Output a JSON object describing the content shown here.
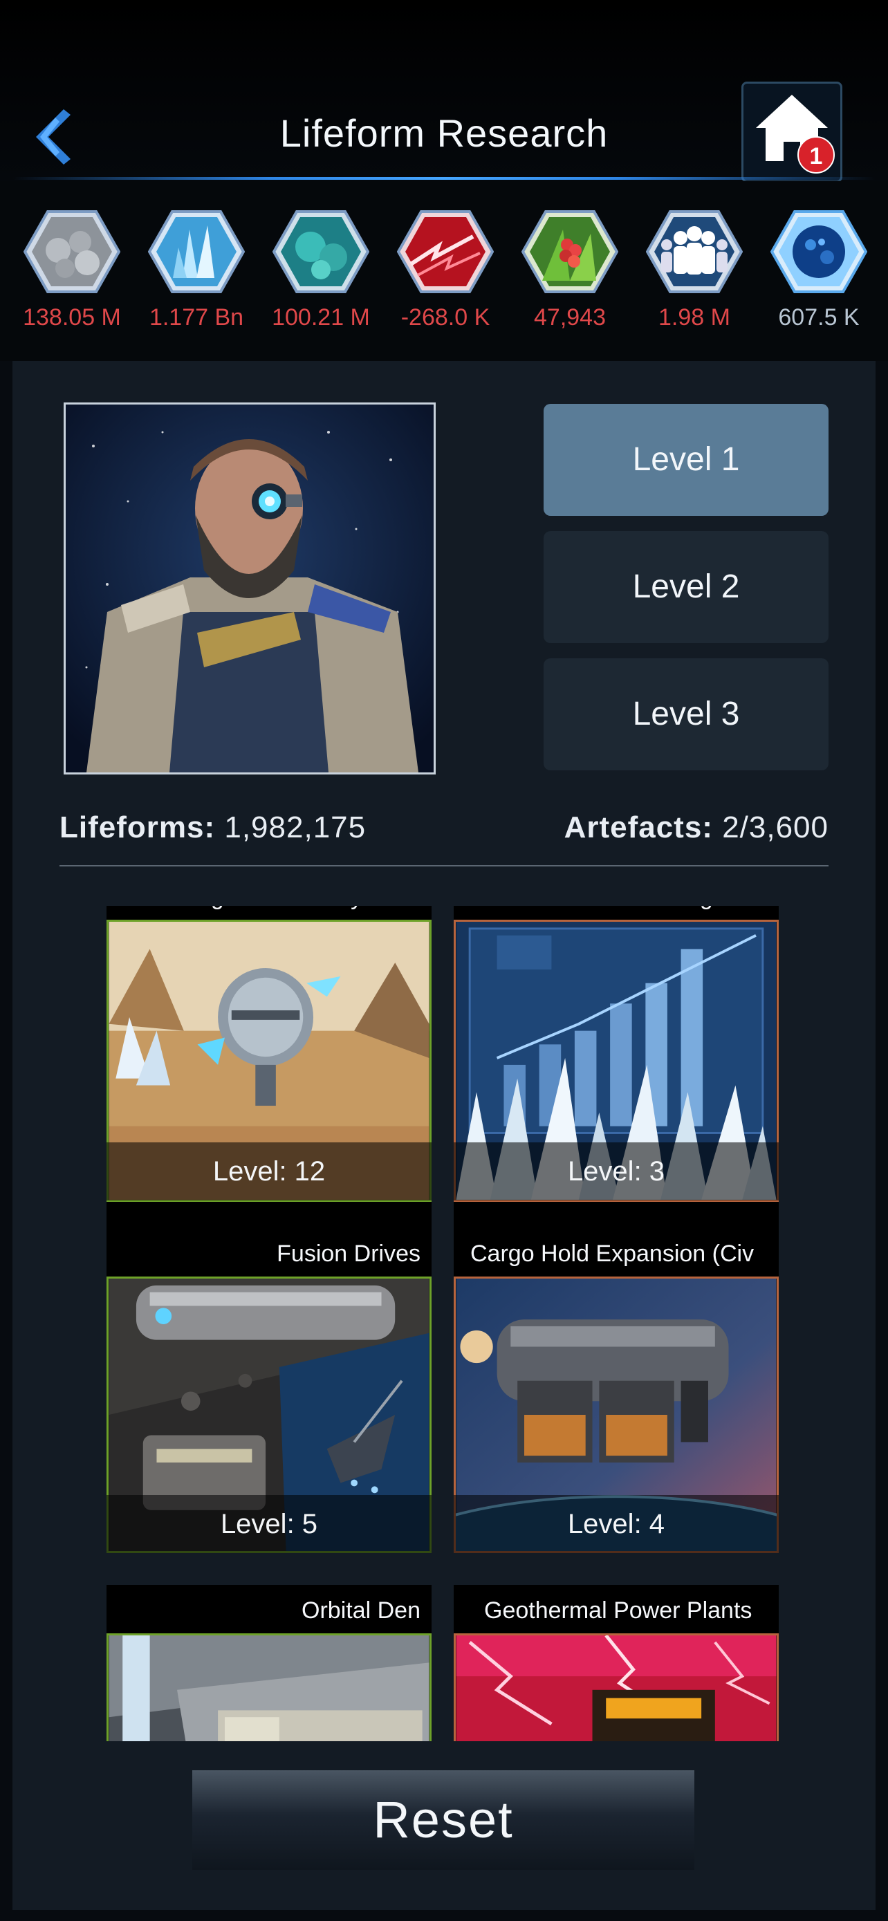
{
  "header": {
    "title": "Lifeform Research",
    "notification_count": "1"
  },
  "resources": [
    {
      "icon": "metal-icon",
      "value": "138.05 M",
      "color": "#e0484a"
    },
    {
      "icon": "crystal-icon",
      "value": "1.177 Bn",
      "color": "#e0484a"
    },
    {
      "icon": "deuterium-icon",
      "value": "100.21 M",
      "color": "#e0484a"
    },
    {
      "icon": "energy-icon",
      "value": "-268.0 K",
      "color": "#e0484a"
    },
    {
      "icon": "food-icon",
      "value": "47,943",
      "color": "#e0484a"
    },
    {
      "icon": "population-icon",
      "value": "1.98 M",
      "color": "#e0484a"
    },
    {
      "icon": "dark-matter-icon",
      "value": "607.5 K",
      "color": "#b9c6d3"
    }
  ],
  "levels": [
    {
      "label": "Level 1",
      "active": true
    },
    {
      "label": "Level 2",
      "active": false
    },
    {
      "label": "Level 3",
      "active": false
    }
  ],
  "stats": {
    "lifeforms_label": "Lifeforms:",
    "lifeforms_value": "1,982,175",
    "artefacts_label": "Artefacts:",
    "artefacts_value": "2/3,600"
  },
  "cards": [
    {
      "title": "Intergalactic Envoys",
      "level": "Level: 12",
      "border": "green"
    },
    {
      "title": "Acoustic Scanning",
      "level": "Level: 3",
      "border": "orange"
    },
    {
      "title": "Fusion Drives",
      "level": "Level: 5",
      "border": "green"
    },
    {
      "title": "Cargo Hold Expansion (Civ",
      "level": "Level: 4",
      "border": "orange"
    },
    {
      "title": "Orbital Den",
      "level": "",
      "border": "green"
    },
    {
      "title": "Geothermal Power Plants",
      "level": "",
      "border": "orange"
    }
  ],
  "reset_label": "Reset"
}
